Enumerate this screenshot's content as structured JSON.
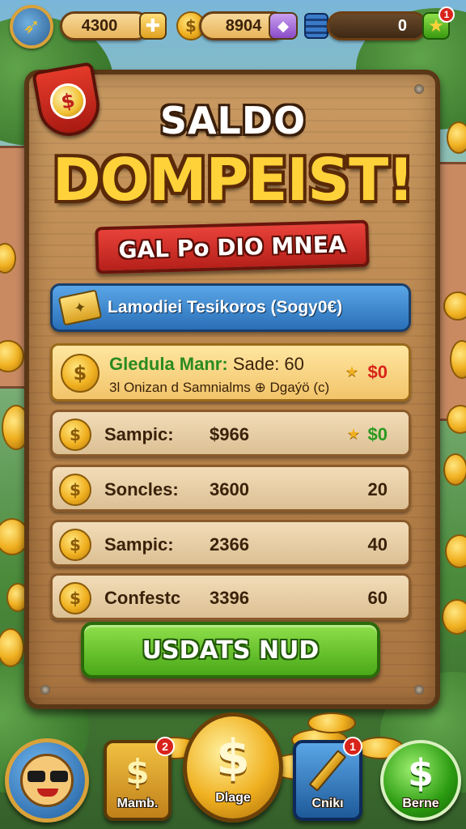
{
  "hud": {
    "avatar_icon": "rocket-icon",
    "coins_value": "4300",
    "coins_plus_icon": "plus-icon",
    "gold_value": "8904",
    "gem_icon": "gem-icon",
    "stack_icon": "coin-stack-icon",
    "counter_value": "0",
    "star_button_icon": "star-icon",
    "star_badge": "1"
  },
  "panel": {
    "shield_icon": "dollar-shield-icon",
    "title_small": "SALDO",
    "title_big": "DOMPEIST!",
    "ribbon": "GAL Po DIO MNEA",
    "info_bar": "Lamodiei Tesikoros (Sogy0€)",
    "featured": {
      "name": "Gledula Manr:",
      "extra": "Sade: 60",
      "subtitle": "3l Onizan d Samnialms ⊕ Dgaýö (c)",
      "reward": "$0"
    },
    "rows": [
      {
        "label": "Sampic:",
        "amount": "$966",
        "reward": "$0",
        "starred": true
      },
      {
        "label": "Soncles:",
        "amount": "3600",
        "reward": "20",
        "starred": false
      },
      {
        "label": "Sampic:",
        "amount": "2366",
        "reward": "40",
        "starred": false
      },
      {
        "label": "Confestc",
        "amount": "3396",
        "reward": "60",
        "starred": false
      }
    ],
    "cta": "USDATS NUD"
  },
  "nav": {
    "items": [
      {
        "label": "",
        "icon": "sunglasses-avatar-icon"
      },
      {
        "label": "Mamb.",
        "icon": "dollar-card-icon",
        "badge": "2"
      },
      {
        "label": "Dlage",
        "icon": "big-dollar-coin-icon"
      },
      {
        "label": "Cnikı",
        "icon": "pencil-icon",
        "badge": "1"
      },
      {
        "label": "Berne",
        "icon": "green-dollar-icon"
      }
    ]
  },
  "colors": {
    "wood": "#b8844c",
    "gold": "#ffd23a",
    "ribbon_red": "#d8231a",
    "cta_green": "#4aa818",
    "info_blue": "#2a6fb8"
  }
}
